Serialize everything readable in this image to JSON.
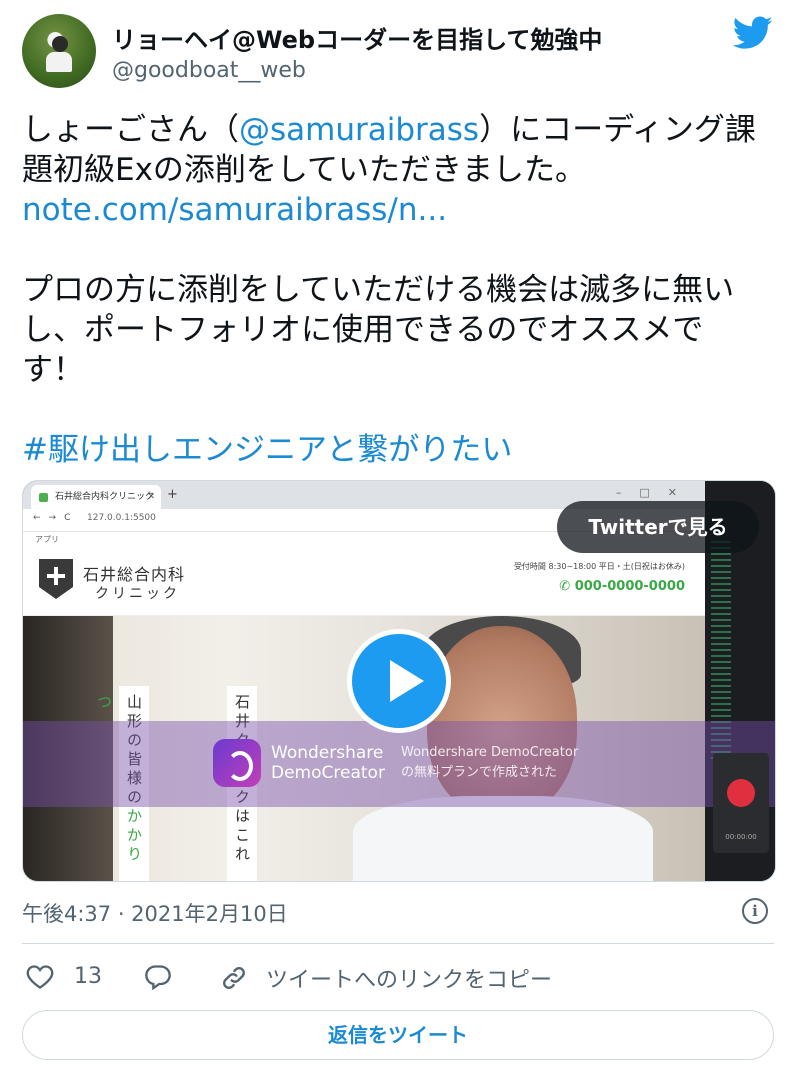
{
  "author": {
    "name": "リョーヘイ@Webコーダーを目指して勉強中",
    "handle": "@goodboat__web"
  },
  "tweet": {
    "line1_pre": "しょーごさん（",
    "line1_mention": "@samuraibrass",
    "line1_post": "）にコーディング課",
    "line2": "題初級Exの添削をしていただきました。",
    "link": "note.com/samuraibrass/n...",
    "para2_line1": "プロの方に添削をしていただける機会は滅多に無い",
    "para2_line2": "し、ポートフォリオに使用できるのでオススメで",
    "para2_line3": "す！",
    "hashtag": "#駆け出しエンジニアと繋がりたい"
  },
  "media": {
    "watch_label": "Twitterで見る",
    "browser": {
      "tab_title": "石井総合内科クリニック",
      "url": "127.0.0.1:5500",
      "bookmarks": "アプリ"
    },
    "site": {
      "clinic_name": "石井総合内科",
      "clinic_sub": "クリニック",
      "hours": "受付時間 8:30~18:00 平日・土(日祝はお休み)",
      "phone": "000-0000-0000",
      "vtext1_a": "山形の皆様の",
      "vtext1_b": "かかりつ",
      "vtext2": "石井ク　ックはこれ"
    },
    "watermark": {
      "brand_line1": "Wondershare",
      "brand_line2": "DemoCreator",
      "note_line1": "Wondershare DemoCreator",
      "note_line2": "の無料プランで作成された"
    },
    "recorder_time": "00:00:00"
  },
  "timestamp": "午後4:37 · 2021年2月10日",
  "actions": {
    "like_count": "13",
    "copy_link": "ツイートへのリンクをコピー"
  },
  "reply_button": "返信をツイート",
  "colors": {
    "link": "#1b8ad2",
    "play": "#1d9bf0",
    "phone_green": "#3aa845"
  }
}
